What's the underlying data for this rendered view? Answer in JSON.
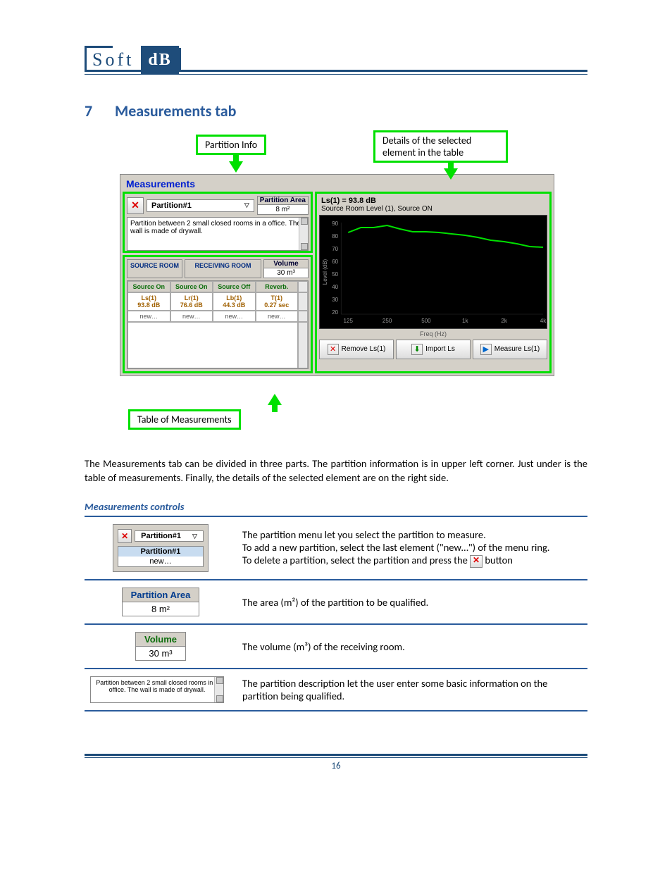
{
  "logo": {
    "left": "Soft",
    "right": "dB"
  },
  "heading": {
    "num": "7",
    "title": "Measurements tab"
  },
  "callouts": {
    "partition_info": "Partition Info",
    "details": "Details of the selected element in the table",
    "table": "Table of Measurements"
  },
  "app": {
    "title": "Measurements",
    "partition": {
      "name": "Partition#1",
      "area_label": "Partition Area",
      "area_value": "8 m²",
      "description": "Partition between 2 small closed rooms in a office. The wall is made of drywall."
    },
    "rooms": {
      "source_room": "SOURCE ROOM",
      "receiving_room": "RECEIVING ROOM",
      "volume_label": "Volume",
      "volume_value": "30 m³"
    },
    "table": {
      "sub": [
        "Source On",
        "Source On",
        "Source Off",
        "Reverb."
      ],
      "labels": [
        "Ls(1)",
        "Lr(1)",
        "Lb(1)",
        "T(1)"
      ],
      "values": [
        "93.8 dB",
        "76.6 dB",
        "44.3 dB",
        "0.27 sec"
      ],
      "new": "new…"
    },
    "chart_header": {
      "title": "Ls(1) = 93.8 dB",
      "subtitle": "Source Room Level (1), Source ON"
    },
    "buttons": {
      "remove": "Remove Ls(1)",
      "import": "Import Ls",
      "measure": "Measure Ls(1)"
    }
  },
  "chart_data": {
    "type": "line",
    "title": "Ls(1) = 93.8 dB",
    "xlabel": "Freq (Hz)",
    "ylabel": "Level (dB)",
    "x_categories": [
      "125",
      "250",
      "500",
      "1k",
      "2k",
      "4k"
    ],
    "y_ticks": [
      20,
      30,
      40,
      50,
      60,
      70,
      80,
      90
    ],
    "ylim": [
      20,
      95
    ],
    "series": [
      {
        "name": "Ls(1)",
        "x": [
          125,
          160,
          200,
          250,
          315,
          400,
          500,
          630,
          800,
          1000,
          1250,
          1600,
          2000,
          2500,
          3150,
          4000
        ],
        "y": [
          84,
          88,
          88,
          90,
          87,
          85,
          85,
          84,
          83,
          82,
          80,
          78,
          77,
          75,
          73,
          72
        ]
      }
    ]
  },
  "body_text": "The Measurements tab can be divided in three parts. The partition information is in upper left corner. Just under is the table of measurements. Finally, the details of the selected element are on the right side.",
  "sub_heading": "Measurements controls",
  "controls": [
    {
      "img": "partition_menu",
      "text1": "The partition menu let you select the partition to measure.",
      "text2": "To add a new partition, select the last element (\"new…\") of the menu ring.",
      "text3_a": "To delete a partition, select the partition and press the ",
      "text3_b": " button"
    },
    {
      "img": "area",
      "text": "The area (m²) of the partition to be qualified."
    },
    {
      "img": "volume",
      "text": "The volume (m³) of the receiving room."
    },
    {
      "img": "desc",
      "text": "The partition description let the user enter some basic information on the partition being qualified."
    }
  ],
  "mini": {
    "partition": "Partition#1",
    "dd_sel": "Partition#1",
    "dd_new": "new…",
    "area_l": "Partition Area",
    "area_v": "8 m²",
    "vol_l": "Volume",
    "vol_v": "30 m³",
    "desc": "Partition between 2 small closed rooms in a office. The wall is made of drywall."
  },
  "page_number": "16"
}
